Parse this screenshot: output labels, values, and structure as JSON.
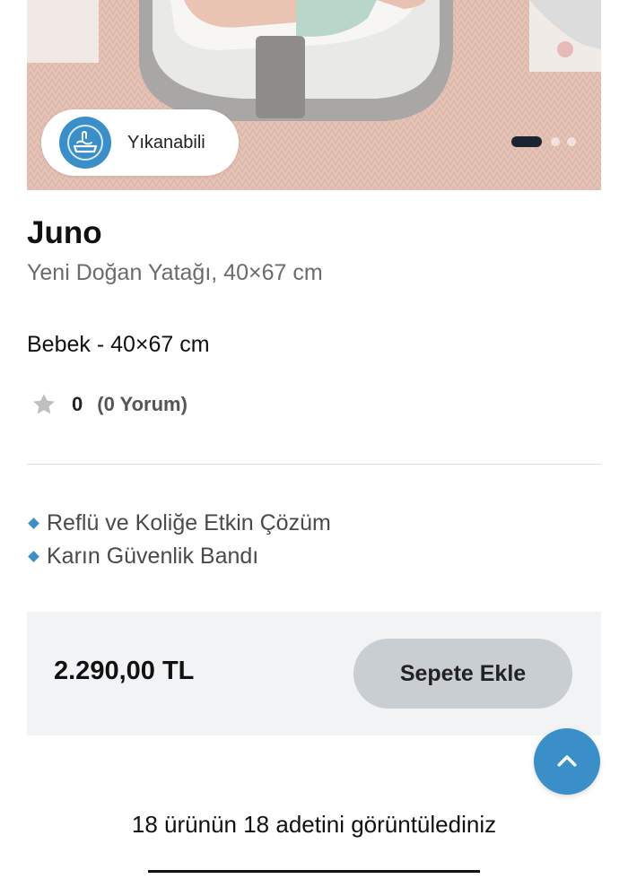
{
  "hero": {
    "badge_label": "Yıkanabili",
    "badge_icon": "washable-icon",
    "slide_dots": 3,
    "active_slide": 1
  },
  "product": {
    "name": "Juno",
    "subtitle": "Yeni Doğan Yatağı, 40×67 cm",
    "variant": "Bebek - 40×67 cm",
    "rating": {
      "value": "0",
      "count_label": "(0 Yorum)",
      "stars": 0
    },
    "features": [
      "Reflü ve Koliğe Etkin Çözüm",
      "Karın Güvenlik Bandı"
    ]
  },
  "purchase": {
    "price": "2.290,00 TL",
    "add_to_cart_label": "Sepete Ekle"
  },
  "footer": {
    "count_text": "18 ürünün 18 adetini görüntülediniz"
  },
  "colors": {
    "accent": "#3a8fc9",
    "button_bg": "#c9ced3",
    "price_bar_bg": "#f1f3f5",
    "star_empty": "#bfbfbf"
  }
}
